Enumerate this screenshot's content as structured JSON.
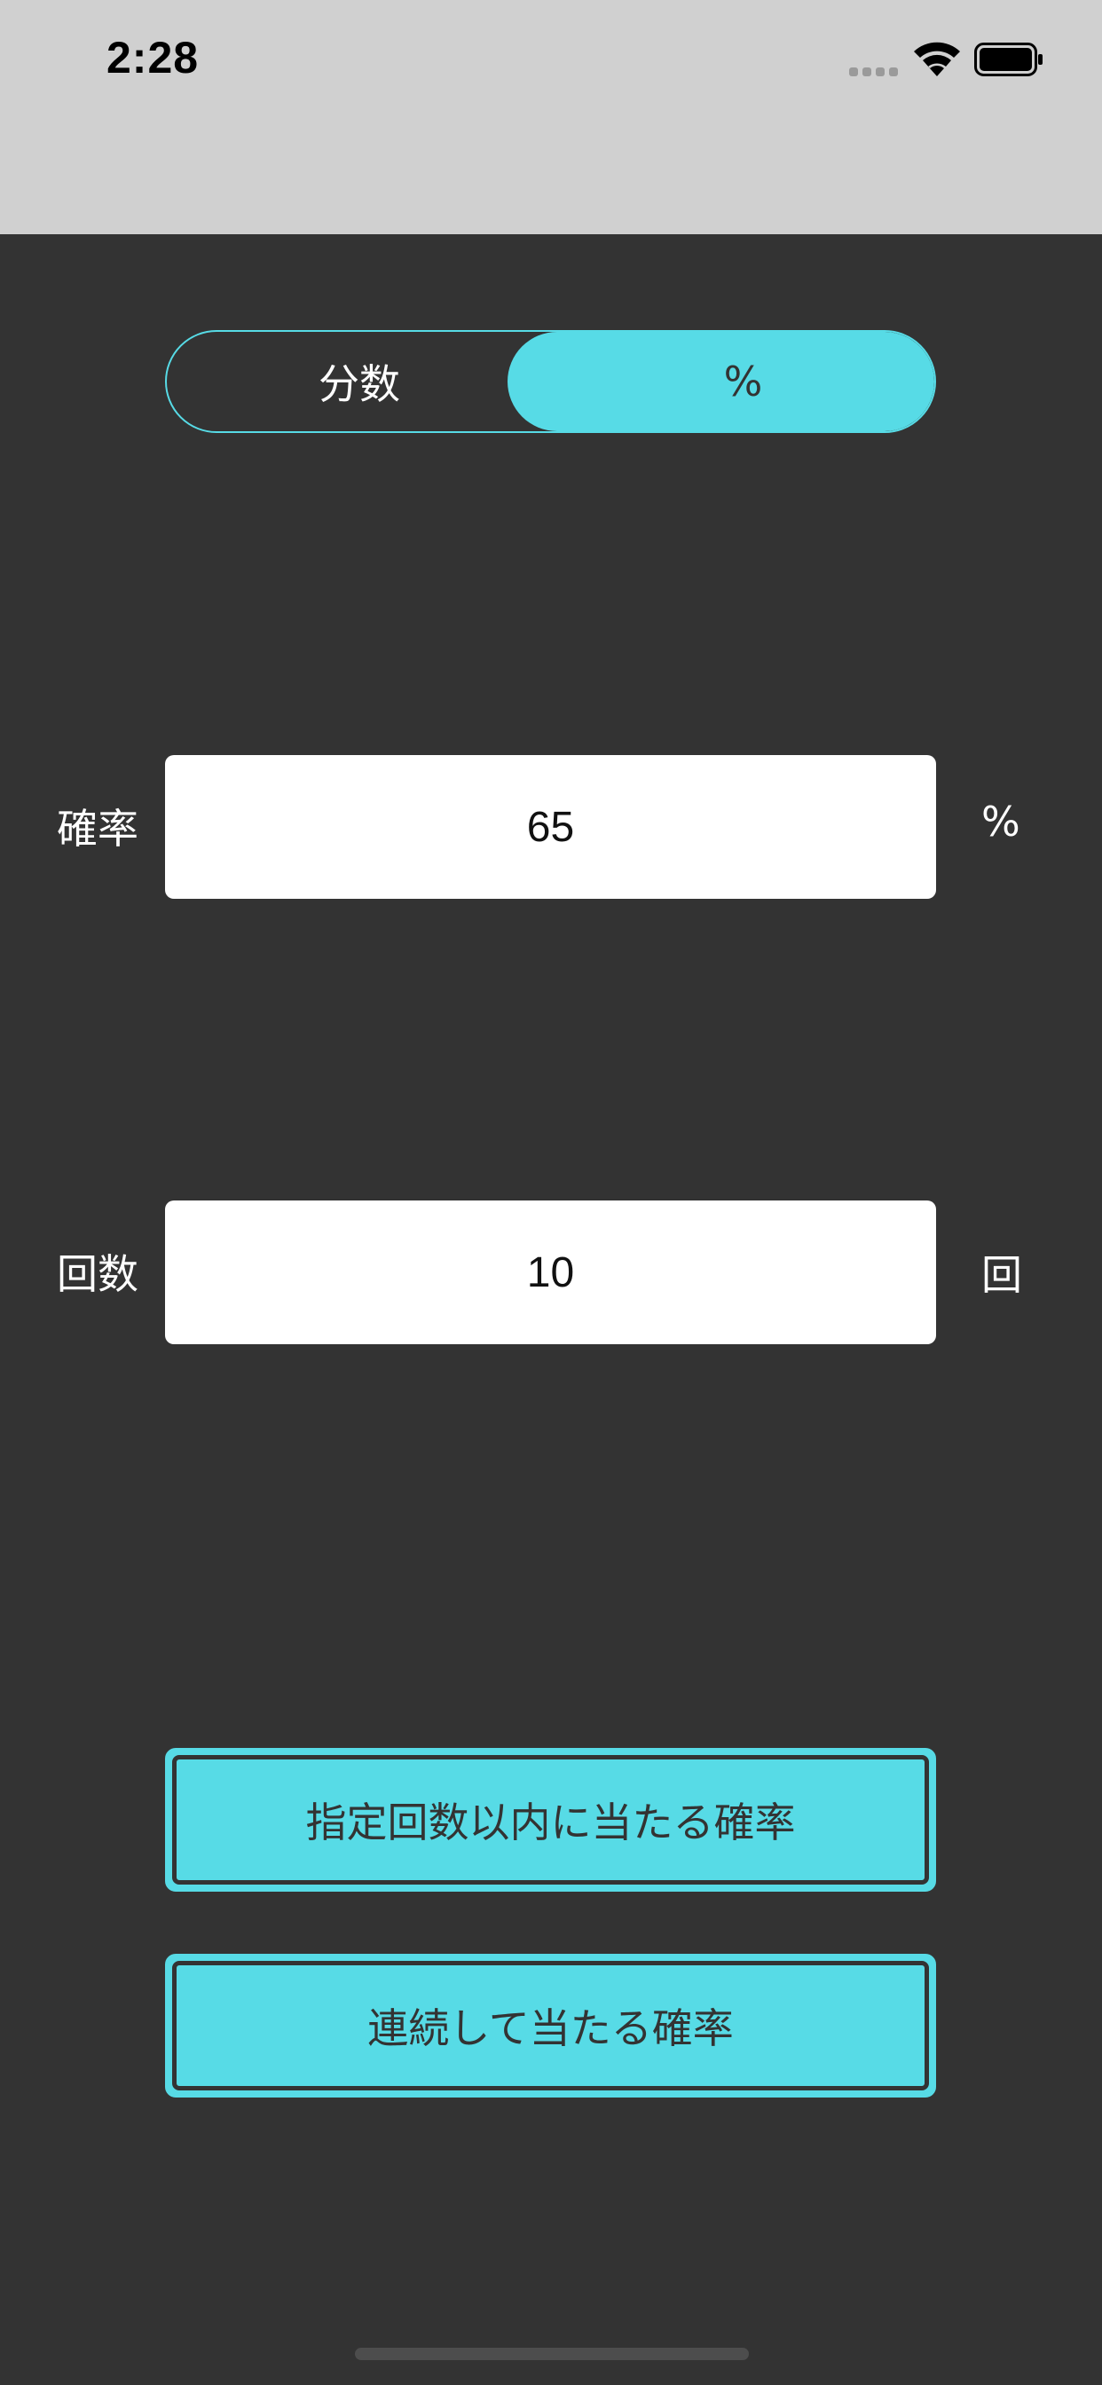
{
  "status_bar": {
    "time": "2:28",
    "signal_icon": "cellular-signal-icon",
    "wifi_icon": "wifi-icon",
    "battery_icon": "battery-icon"
  },
  "mode_toggle": {
    "options": [
      "分数",
      "%"
    ],
    "selected": "%"
  },
  "probability": {
    "label": "確率",
    "value": "65",
    "unit": "%"
  },
  "count": {
    "label": "回数",
    "value": "10",
    "unit": "回"
  },
  "buttons": {
    "within_count": "指定回数以内に当たる確率",
    "consecutive": "連続して当たる確率"
  },
  "colors": {
    "accent": "#57dbe6",
    "background": "#333333",
    "status_bar": "#d0d0d0"
  }
}
